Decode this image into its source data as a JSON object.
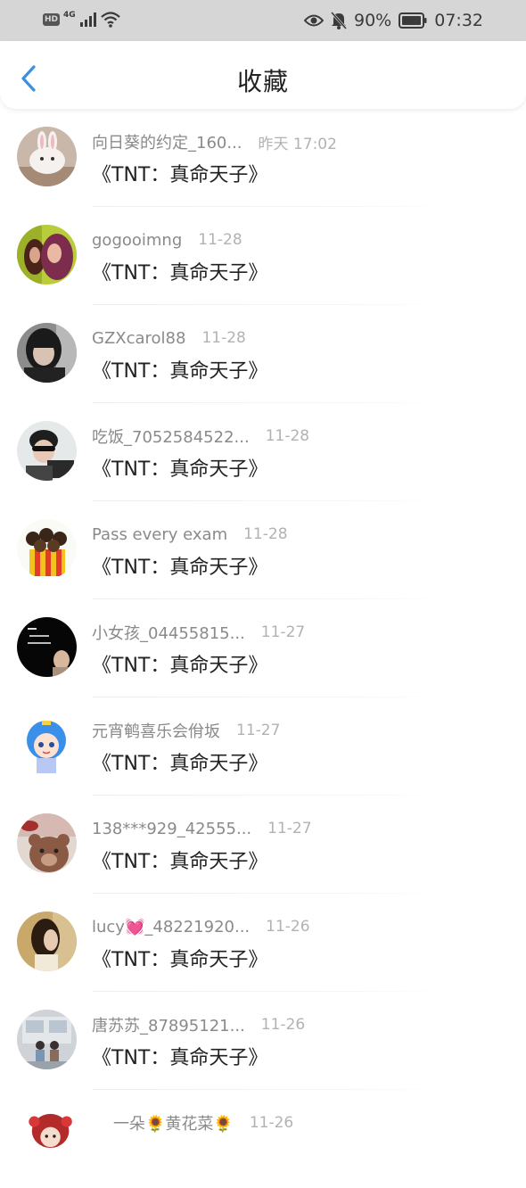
{
  "status_bar": {
    "hd": "HD",
    "network": "4G",
    "battery": "90%",
    "time": "07:32",
    "icons": [
      "hd-icon",
      "signal-icon",
      "wifi-icon",
      "eye-icon",
      "mute-bell-icon",
      "battery-icon"
    ]
  },
  "header": {
    "title": "收藏",
    "back_icon": "chevron-left-icon",
    "accent": "#3d8fe0"
  },
  "items": [
    {
      "name": "向日葵的约定_160...",
      "time": "昨天 17:02",
      "title": "《TNT：真命天子》"
    },
    {
      "name": "gogooimng",
      "time": "11-28",
      "title": "《TNT：真命天子》"
    },
    {
      "name": "GZXcarol88",
      "time": "11-28",
      "title": "《TNT：真命天子》"
    },
    {
      "name": "吃饭_7052584522...",
      "time": "11-28",
      "title": "《TNT：真命天子》"
    },
    {
      "name": "Pass every exam",
      "time": "11-28",
      "title": "《TNT：真命天子》"
    },
    {
      "name": "小女孩_04455815...",
      "time": "11-27",
      "title": "《TNT：真命天子》"
    },
    {
      "name": "元宵鹌喜乐会佾坂",
      "time": "11-27",
      "title": "《TNT：真命天子》"
    },
    {
      "name": "138***929_42555...",
      "time": "11-27",
      "title": "《TNT：真命天子》"
    },
    {
      "name": "lucy💓_48221920...",
      "time": "11-26",
      "title": "《TNT：真命天子》"
    },
    {
      "name": "唐苏苏_87895121...",
      "time": "11-26",
      "title": "《TNT：真命天子》"
    },
    {
      "name": "一朵🌻黄花菜🌻",
      "time": "11-26",
      "title": ""
    }
  ]
}
